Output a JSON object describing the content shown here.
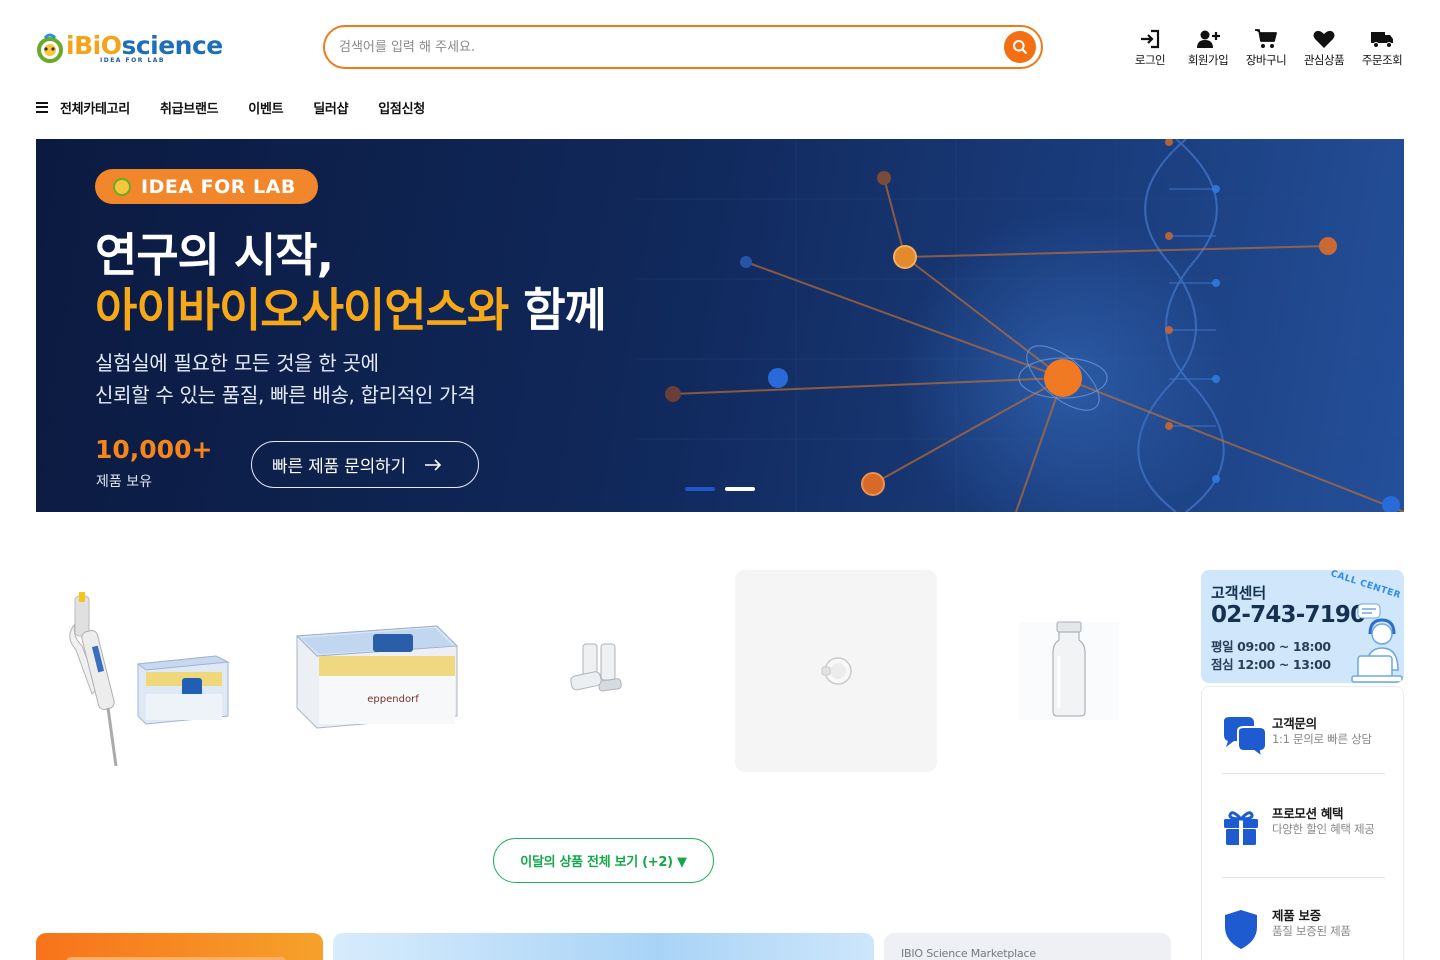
{
  "brand": {
    "logo_name": "iBiO",
    "logo_science": "science",
    "tagline": "IDEA FOR LAB"
  },
  "search": {
    "placeholder": "검색어를 입력 해 주세요."
  },
  "top_menu": {
    "login": "로그인",
    "signup": "회원가입",
    "cart": "장바구니",
    "wishlist": "관심상품",
    "orders": "주문조회"
  },
  "nav": {
    "all_categories": "전체카테고리",
    "brands": "취급브랜드",
    "events": "이벤트",
    "dealer_shop": "딜러샵",
    "vendor_apply": "입점신청"
  },
  "hero": {
    "badge": "IDEA FOR LAB",
    "title_line1": "연구의 시작,",
    "title_highlight": "아이바이오사이언스와",
    "title_rest": "함께",
    "subtitle_line1": "실험실에 필요한 모든 것을 한 곳에",
    "subtitle_line2": "신뢰할 수 있는 품질, 빠른 배송, 합리적인 가격",
    "stat_number": "10,000+",
    "stat_label": "제품 보유",
    "cta_label": "빠른 제품 문의하기",
    "slide_count": 2,
    "active_slide": 2
  },
  "products": {
    "items": [
      {
        "icon": "pipette-and-tip-box"
      },
      {
        "icon": "eppendorf-tip-rack"
      },
      {
        "icon": "small-vials"
      },
      {
        "icon": "vial-cap"
      },
      {
        "icon": "glass-vial"
      }
    ],
    "more_label": "이달의 상품 전체 보기 (+2) ▼"
  },
  "customer_center": {
    "title": "고객센터",
    "phone": "02-743-7190",
    "weekday_hours": "평일 09:00 ~ 18:00",
    "lunch_hours": "점심 12:00 ~ 13:00",
    "badge": "CALL CENTER"
  },
  "services": [
    {
      "title": "고객문의",
      "desc": "1:1 문의로 빠른 상담",
      "icon": "chat-bubbles-icon"
    },
    {
      "title": "프로모션 혜택",
      "desc": "다양한 할인 혜택 제공",
      "icon": "gift-icon"
    },
    {
      "title": "제품 보증",
      "desc": "품질 보증된 제품",
      "icon": "shield-icon"
    }
  ],
  "bottom_banners": {
    "marketplace_label": "IBIO Science Marketplace"
  },
  "colors": {
    "accent_orange": "#f36f12",
    "hero_highlight": "#f6a818",
    "green": "#20b259",
    "navy": "#10285a",
    "service_blue": "#1f5bd0"
  }
}
